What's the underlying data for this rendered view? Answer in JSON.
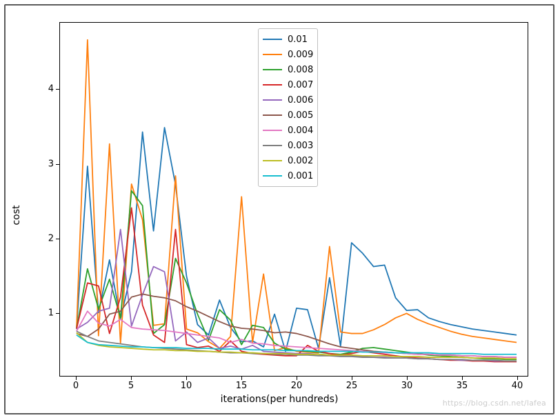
{
  "chart_data": {
    "type": "line",
    "title": "",
    "xlabel": "iterations(per hundreds)",
    "ylabel": "cost",
    "xlim": [
      -1.5,
      41
    ],
    "ylim": [
      0.15,
      4.9
    ],
    "x": [
      0,
      1,
      2,
      3,
      4,
      5,
      6,
      7,
      8,
      9,
      10,
      11,
      12,
      13,
      14,
      15,
      16,
      17,
      18,
      19,
      20,
      21,
      22,
      23,
      24,
      25,
      26,
      27,
      28,
      29,
      30,
      31,
      32,
      33,
      34,
      35,
      36,
      37,
      38,
      39,
      40
    ],
    "x_ticks": [
      0,
      5,
      10,
      15,
      20,
      25,
      30,
      35,
      40
    ],
    "y_ticks": [
      1,
      2,
      3,
      4
    ],
    "legend_position": "upper center",
    "series": [
      {
        "name": "0.01",
        "color": "#1f77b4",
        "values": [
          0.78,
          2.97,
          1.0,
          1.71,
          0.92,
          1.55,
          3.43,
          2.1,
          3.49,
          2.72,
          1.49,
          0.84,
          0.7,
          1.17,
          0.8,
          0.61,
          0.62,
          0.54,
          0.98,
          0.48,
          1.06,
          1.04,
          0.52,
          1.47,
          0.55,
          1.94,
          1.8,
          1.62,
          1.64,
          1.2,
          1.03,
          1.04,
          0.93,
          0.88,
          0.84,
          0.81,
          0.78,
          0.76,
          0.74,
          0.72,
          0.7
        ]
      },
      {
        "name": "0.009",
        "color": "#ff7f0e",
        "values": [
          0.78,
          4.67,
          0.69,
          3.27,
          0.59,
          2.73,
          2.25,
          0.83,
          0.85,
          2.84,
          0.78,
          0.73,
          0.61,
          0.52,
          0.68,
          2.56,
          0.6,
          1.52,
          0.49,
          0.53,
          0.48,
          0.47,
          0.46,
          1.89,
          0.74,
          0.72,
          0.72,
          0.77,
          0.84,
          0.93,
          0.99,
          0.91,
          0.85,
          0.8,
          0.75,
          0.71,
          0.68,
          0.66,
          0.64,
          0.62,
          0.6
        ]
      },
      {
        "name": "0.008",
        "color": "#2ca02c",
        "values": [
          0.78,
          1.59,
          1.05,
          1.45,
          0.93,
          2.64,
          2.44,
          0.72,
          0.84,
          1.73,
          1.4,
          0.98,
          0.63,
          1.04,
          0.9,
          0.57,
          0.83,
          0.8,
          0.59,
          0.51,
          0.49,
          0.48,
          0.47,
          0.45,
          0.44,
          0.47,
          0.52,
          0.53,
          0.51,
          0.49,
          0.47,
          0.45,
          0.43,
          0.42,
          0.41,
          0.4,
          0.39,
          0.38,
          0.38,
          0.37,
          0.37
        ]
      },
      {
        "name": "0.007",
        "color": "#d62728",
        "values": [
          0.78,
          1.4,
          1.36,
          0.72,
          1.21,
          2.41,
          1.1,
          0.7,
          0.6,
          2.12,
          0.57,
          0.53,
          0.55,
          0.48,
          0.62,
          0.48,
          0.45,
          0.44,
          0.43,
          0.42,
          0.42,
          0.56,
          0.48,
          0.45,
          0.43,
          0.45,
          0.48,
          0.46,
          0.44,
          0.42,
          0.4,
          0.39,
          0.38,
          0.37,
          0.36,
          0.36,
          0.35,
          0.35,
          0.34,
          0.34,
          0.34
        ]
      },
      {
        "name": "0.006",
        "color": "#9467bd",
        "values": [
          0.78,
          0.87,
          1.02,
          1.06,
          2.12,
          0.82,
          1.24,
          1.62,
          1.55,
          0.62,
          0.74,
          0.6,
          0.66,
          0.52,
          0.55,
          0.51,
          0.56,
          0.48,
          0.47,
          0.46,
          0.45,
          0.45,
          0.44,
          0.43,
          0.42,
          0.42,
          0.41,
          0.4,
          0.4,
          0.39,
          0.39,
          0.38,
          0.38,
          0.37,
          0.37,
          0.36,
          0.36,
          0.36,
          0.35,
          0.35,
          0.35
        ]
      },
      {
        "name": "0.005",
        "color": "#8c564b",
        "values": [
          0.72,
          0.68,
          0.78,
          0.98,
          1.02,
          1.21,
          1.25,
          1.22,
          1.2,
          1.16,
          1.08,
          1.02,
          0.95,
          0.88,
          0.82,
          0.79,
          0.78,
          0.76,
          0.73,
          0.74,
          0.72,
          0.68,
          0.63,
          0.58,
          0.54,
          0.52,
          0.5,
          0.48,
          0.47,
          0.46,
          0.45,
          0.44,
          0.44,
          0.43,
          0.43,
          0.42,
          0.42,
          0.41,
          0.41,
          0.4,
          0.4
        ]
      },
      {
        "name": "0.004",
        "color": "#e377c2",
        "values": [
          0.75,
          1.02,
          0.86,
          0.82,
          0.91,
          0.8,
          0.78,
          0.77,
          0.76,
          0.74,
          0.72,
          0.7,
          0.68,
          0.66,
          0.6,
          0.64,
          0.59,
          0.58,
          0.56,
          0.55,
          0.54,
          0.53,
          0.52,
          0.51,
          0.5,
          0.49,
          0.48,
          0.47,
          0.46,
          0.46,
          0.45,
          0.44,
          0.44,
          0.43,
          0.43,
          0.42,
          0.42,
          0.41,
          0.41,
          0.4,
          0.4
        ]
      },
      {
        "name": "0.003",
        "color": "#7f7f7f",
        "values": [
          0.75,
          0.68,
          0.62,
          0.6,
          0.58,
          0.56,
          0.54,
          0.53,
          0.52,
          0.51,
          0.5,
          0.49,
          0.48,
          0.47,
          0.46,
          0.46,
          0.45,
          0.45,
          0.44,
          0.44,
          0.43,
          0.43,
          0.42,
          0.42,
          0.41,
          0.41,
          0.4,
          0.4,
          0.39,
          0.39,
          0.39,
          0.38,
          0.38,
          0.37,
          0.37,
          0.37,
          0.36,
          0.36,
          0.36,
          0.35,
          0.35
        ]
      },
      {
        "name": "0.002",
        "color": "#bcbd22",
        "values": [
          0.73,
          0.6,
          0.56,
          0.54,
          0.53,
          0.52,
          0.51,
          0.5,
          0.5,
          0.49,
          0.49,
          0.48,
          0.48,
          0.47,
          0.47,
          0.46,
          0.46,
          0.45,
          0.45,
          0.45,
          0.44,
          0.44,
          0.44,
          0.43,
          0.43,
          0.43,
          0.42,
          0.42,
          0.42,
          0.41,
          0.41,
          0.41,
          0.4,
          0.4,
          0.4,
          0.4,
          0.39,
          0.39,
          0.39,
          0.38,
          0.38
        ]
      },
      {
        "name": "0.001",
        "color": "#17becf",
        "values": [
          0.7,
          0.6,
          0.57,
          0.56,
          0.55,
          0.54,
          0.54,
          0.53,
          0.53,
          0.53,
          0.52,
          0.52,
          0.52,
          0.51,
          0.51,
          0.51,
          0.5,
          0.5,
          0.5,
          0.49,
          0.49,
          0.49,
          0.48,
          0.48,
          0.48,
          0.48,
          0.47,
          0.47,
          0.47,
          0.46,
          0.46,
          0.46,
          0.46,
          0.45,
          0.45,
          0.45,
          0.45,
          0.44,
          0.44,
          0.44,
          0.44
        ]
      }
    ]
  },
  "watermark": "https://blog.csdn.net/lafea"
}
